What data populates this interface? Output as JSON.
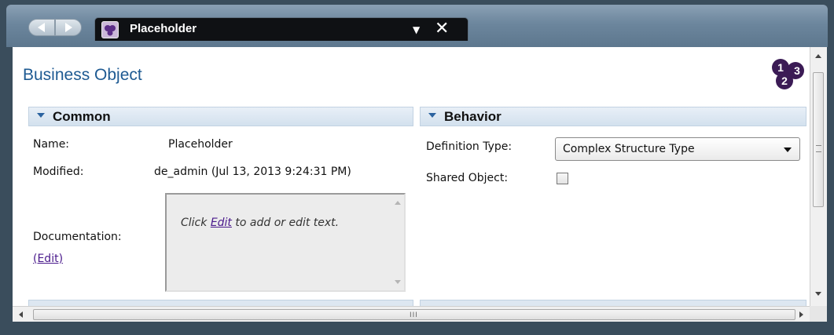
{
  "tab": {
    "title": "Placeholder"
  },
  "page": {
    "title": "Business Object"
  },
  "common": {
    "header": "Common",
    "name_label": "Name:",
    "name_value": "Placeholder",
    "modified_label": "Modified:",
    "modified_value": "de_admin (Jul 13, 2013 9:24:31 PM)",
    "documentation_label": "Documentation:",
    "edit_link": "(Edit)",
    "doc_prefix": "Click ",
    "doc_link": "Edit",
    "doc_suffix": " to add or edit text."
  },
  "behavior": {
    "header": "Behavior",
    "definition_type_label": "Definition Type:",
    "definition_type_value": "Complex Structure Type",
    "shared_object_label": "Shared Object:",
    "shared_object_checked": false
  },
  "logo": {
    "digits": [
      "1",
      "2",
      "3"
    ]
  },
  "colors": {
    "title": "#1e5a92",
    "link": "#4a1a8c",
    "section_header": "#d3e1ee",
    "logo": "#3b1b55"
  },
  "icons": [
    "back-arrow-icon",
    "forward-arrow-icon",
    "business-object-icon",
    "dropdown-arrow-icon",
    "close-icon",
    "section-collapse-icon",
    "numbered-logo-icon"
  ]
}
